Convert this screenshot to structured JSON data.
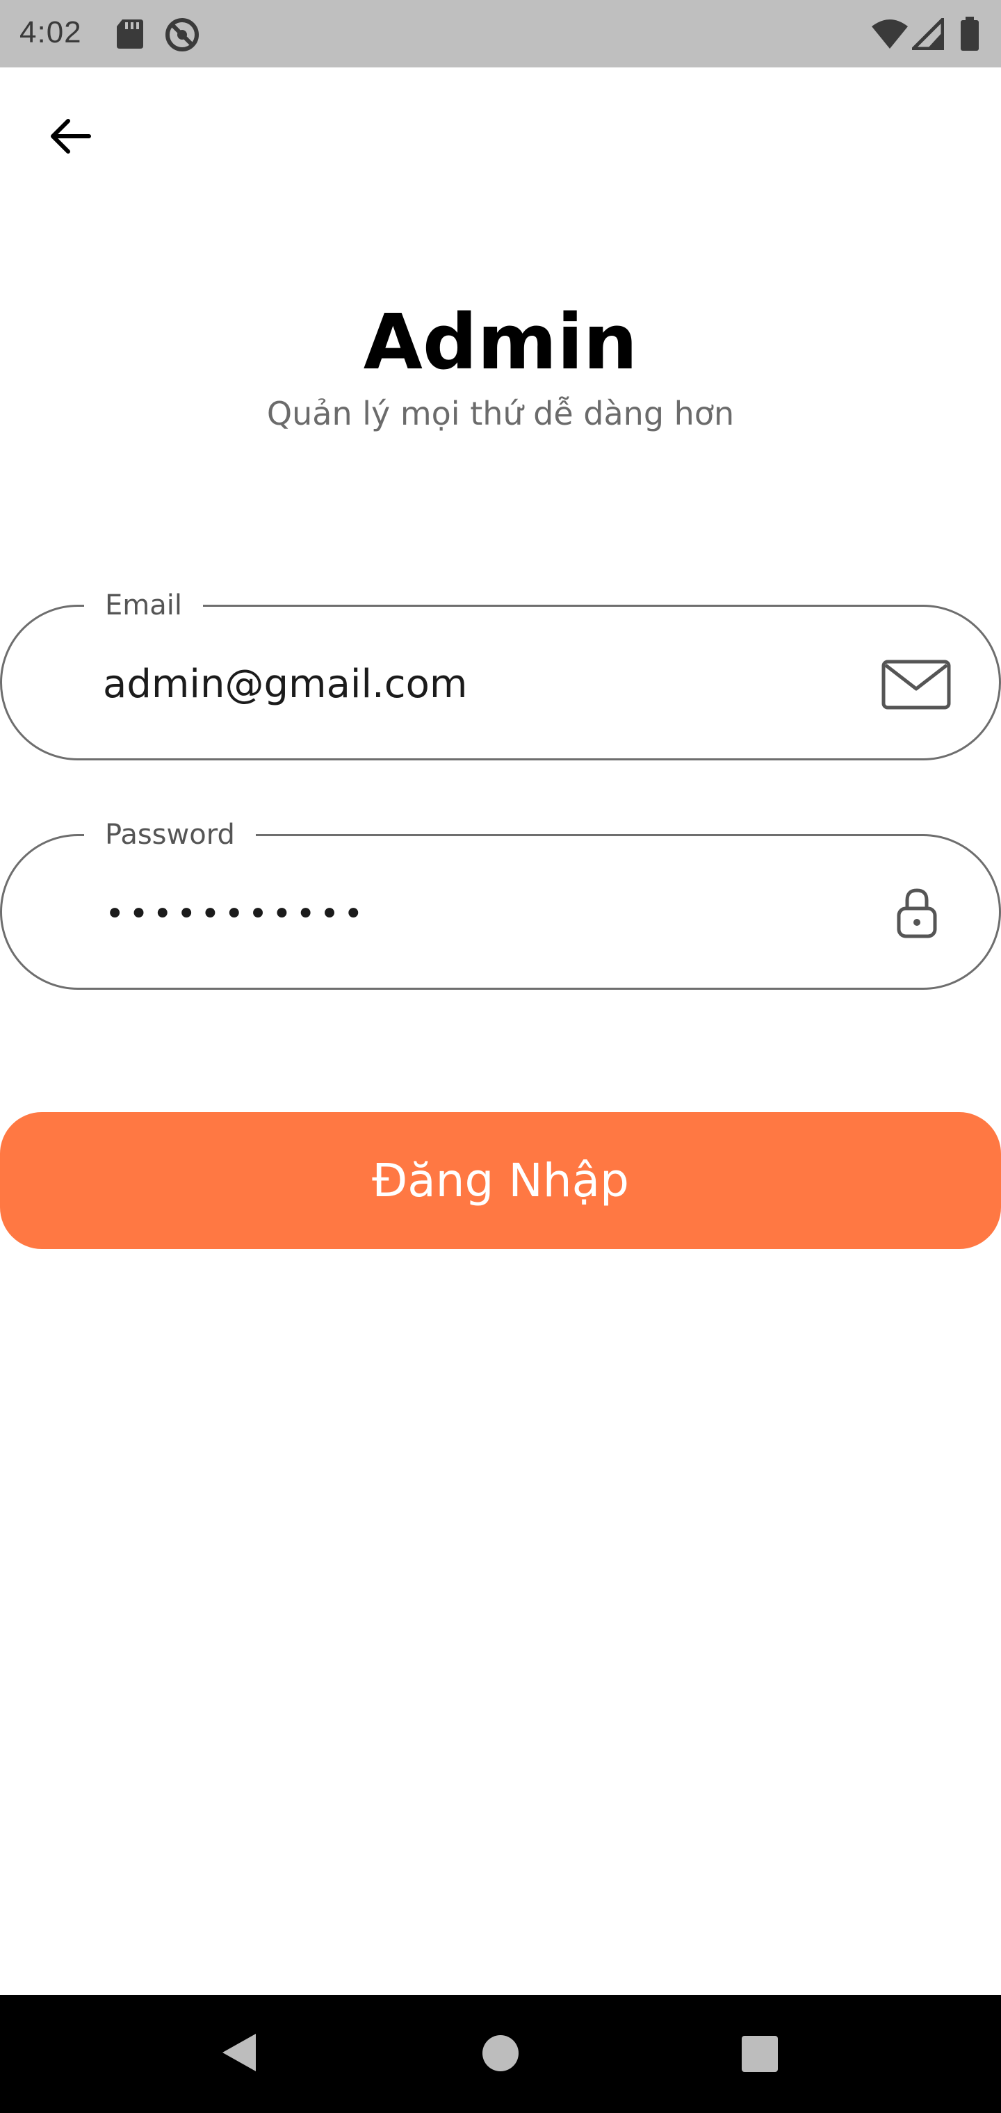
{
  "status_bar": {
    "time": "4:02",
    "icons": [
      "sd-card-icon",
      "do-not-disturb-icon",
      "wifi-icon",
      "cell-signal-icon",
      "battery-icon"
    ]
  },
  "header": {
    "back_icon": "arrow-left-icon"
  },
  "hero": {
    "title": "Admin",
    "subtitle": "Quản lý mọi thứ dễ dàng hơn"
  },
  "form": {
    "email": {
      "label": "Email",
      "value": "admin@gmail.com",
      "icon": "mail-icon"
    },
    "password": {
      "label": "Password",
      "value": "•••••••••••",
      "icon": "lock-icon"
    },
    "submit_label": "Đăng Nhập"
  },
  "nav_bar": {
    "icons": [
      "nav-back-icon",
      "nav-home-icon",
      "nav-recents-icon"
    ]
  },
  "colors": {
    "accent": "#ff7843",
    "status_bar": "#bfbfbf",
    "nav_bar": "#000000",
    "field_border": "#6e6e6e"
  }
}
